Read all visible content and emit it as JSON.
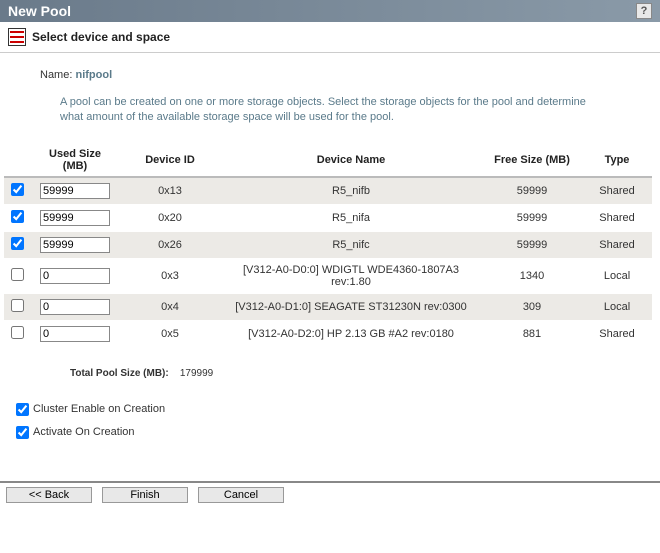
{
  "header": {
    "title": "New Pool",
    "help": "?"
  },
  "subtitle": "Select device and space",
  "name": {
    "label": "Name:",
    "value": "nifpool"
  },
  "description": "A pool can be created on one or more storage objects. Select the storage objects for the pool and determine what amount of the available storage space will be used for the pool.",
  "columns": {
    "check": "",
    "used": "Used Size (MB)",
    "device_id": "Device ID",
    "device_name": "Device Name",
    "free": "Free Size (MB)",
    "type": "Type"
  },
  "rows": [
    {
      "checked": true,
      "used": "59999",
      "device_id": "0x13",
      "device_name": "R5_nifb",
      "free": "59999",
      "type": "Shared"
    },
    {
      "checked": true,
      "used": "59999",
      "device_id": "0x20",
      "device_name": "R5_nifa",
      "free": "59999",
      "type": "Shared"
    },
    {
      "checked": true,
      "used": "59999",
      "device_id": "0x26",
      "device_name": "R5_nifc",
      "free": "59999",
      "type": "Shared"
    },
    {
      "checked": false,
      "used": "0",
      "device_id": "0x3",
      "device_name": "[V312-A0-D0:0] WDIGTL WDE4360-1807A3 rev:1.80",
      "free": "1340",
      "type": "Local"
    },
    {
      "checked": false,
      "used": "0",
      "device_id": "0x4",
      "device_name": "[V312-A0-D1:0] SEAGATE ST31230N rev:0300",
      "free": "309",
      "type": "Local"
    },
    {
      "checked": false,
      "used": "0",
      "device_id": "0x5",
      "device_name": "[V312-A0-D2:0] HP 2.13 GB #A2 rev:0180",
      "free": "881",
      "type": "Shared"
    }
  ],
  "total": {
    "label": "Total Pool Size (MB):",
    "value": "179999"
  },
  "options": {
    "cluster_enable": {
      "label": "Cluster Enable on Creation",
      "checked": true
    },
    "activate": {
      "label": "Activate On Creation",
      "checked": true
    }
  },
  "buttons": {
    "back": "<<  Back",
    "finish": "Finish",
    "cancel": "Cancel"
  }
}
